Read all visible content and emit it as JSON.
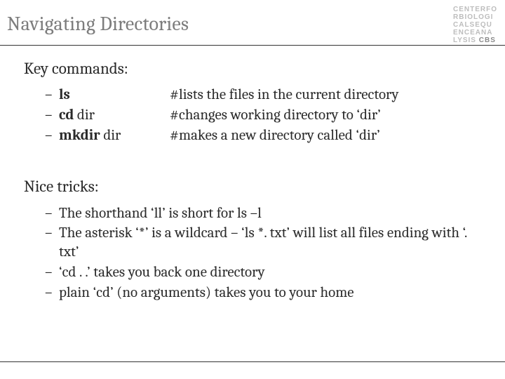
{
  "logo": {
    "line1": "CENTERFO",
    "line2": "RBIOLOGI",
    "line3": "CALSEQU",
    "line4": "ENCEANA",
    "line5_a": "LYSIS ",
    "line5_b": "CBS"
  },
  "title": "Navigating Directories",
  "sections": {
    "commands_heading": "Key commands:",
    "tricks_heading": "Nice tricks:"
  },
  "commands": [
    {
      "cmd_bold": "ls",
      "cmd_rest": "",
      "desc": "#lists the files in the current directory"
    },
    {
      "cmd_bold": "cd",
      "cmd_rest": " dir",
      "desc": "#changes working directory to ‘dir’"
    },
    {
      "cmd_bold": "mkdir",
      "cmd_rest": " dir",
      "desc": "#makes a new directory called ‘dir’"
    }
  ],
  "tricks": [
    "The shorthand ‘ll’ is short for ls –l",
    "The asterisk ‘*’ is a wildcard – ‘ls *. txt’ will list all files ending with ‘. txt’",
    "‘cd . .’ takes you back one directory",
    "plain ‘cd’ (no arguments) takes you to your home"
  ]
}
